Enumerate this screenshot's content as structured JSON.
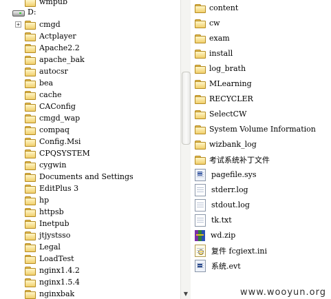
{
  "tree": {
    "partial_top_label": "wmpub",
    "drive_label": "D:",
    "expander_symbol": "+",
    "folders": [
      "cmgd",
      "Actplayer",
      "Apache2.2",
      "apache_bak",
      "autocsr",
      "bea",
      "cache",
      "CAConfig",
      "cmgd_wap",
      "compaq",
      "Config.Msi",
      "CPQSYSTEM",
      "cygwin",
      "Documents and Settings",
      "EditPlus 3",
      "hp",
      "httpsb",
      "Inetpub",
      "jtjystsso",
      "Legal",
      "LoadTest",
      "nginx1.4.2",
      "nginx1.5.4",
      "nginxbak"
    ]
  },
  "scrollbar": {
    "down_arrow": "▼"
  },
  "files": {
    "folders": [
      "content",
      "cw",
      "exam",
      "install",
      "log_brath",
      "MLearning",
      "RECYCLER",
      "SelectCW",
      "System Volume Information",
      "wizbank_log",
      "考试系统补丁文件"
    ],
    "items": [
      {
        "name": "pagefile.sys",
        "icon": "sys-file-icon"
      },
      {
        "name": "stderr.log",
        "icon": "log-file-icon"
      },
      {
        "name": "stdout.log",
        "icon": "log-file-icon"
      },
      {
        "name": "tk.txt",
        "icon": "text-file-icon"
      },
      {
        "name": "wd.zip",
        "icon": "zip-archive-icon"
      },
      {
        "name": "复件 fcgiext.ini",
        "icon": "ini-file-icon"
      },
      {
        "name": "系统.evt",
        "icon": "event-log-icon"
      }
    ]
  },
  "watermark": "www.wooyun.org"
}
